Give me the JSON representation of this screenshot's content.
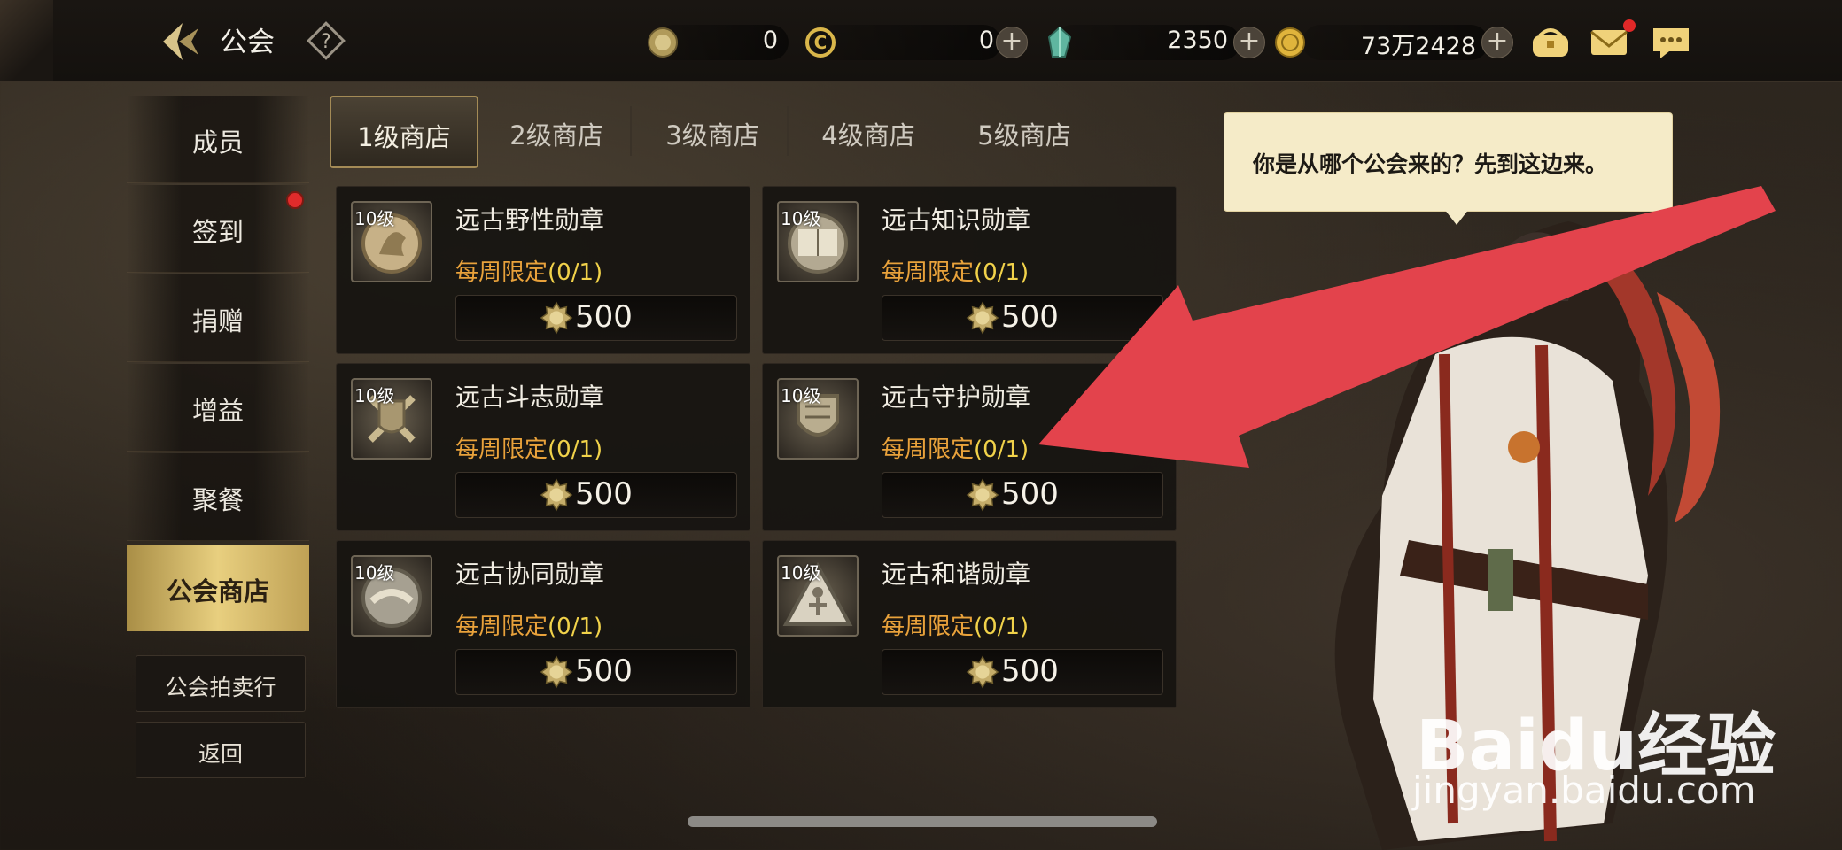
{
  "header": {
    "title": "公会",
    "resources": [
      {
        "icon": "guild-coin-icon",
        "value": "0",
        "has_plus": false
      },
      {
        "icon": "c-currency-icon",
        "value": "0",
        "has_plus": true
      },
      {
        "icon": "crystal-icon",
        "value": "2350",
        "has_plus": true
      },
      {
        "icon": "gold-coin-icon",
        "value": "73万2428",
        "has_plus": true
      }
    ],
    "plus_label": "+"
  },
  "sidebar": {
    "items": [
      {
        "label": "成员",
        "has_dot": false
      },
      {
        "label": "签到",
        "has_dot": true
      },
      {
        "label": "捐赠",
        "has_dot": false
      },
      {
        "label": "增益",
        "has_dot": false
      },
      {
        "label": "聚餐",
        "has_dot": false
      },
      {
        "label": "公会商店",
        "active": true
      }
    ],
    "auction_label": "公会拍卖行",
    "back_label": "返回"
  },
  "tabs": [
    {
      "label": "1级商店",
      "active": true
    },
    {
      "label": "2级商店"
    },
    {
      "label": "3级商店"
    },
    {
      "label": "4级商店"
    },
    {
      "label": "5级商店"
    }
  ],
  "shop": {
    "items": [
      {
        "level": "10级",
        "name": "远古野性勋章",
        "limit_text": "每周限定",
        "limit_count": "(0/1)",
        "price": "500",
        "icon": "wild-medal-icon"
      },
      {
        "level": "10级",
        "name": "远古知识勋章",
        "limit_text": "每周限定",
        "limit_count": "(0/1)",
        "price": "500",
        "icon": "knowledge-medal-icon"
      },
      {
        "level": "10级",
        "name": "远古斗志勋章",
        "limit_text": "每周限定",
        "limit_count": "(0/1)",
        "price": "500",
        "icon": "fighting-medal-icon"
      },
      {
        "level": "10级",
        "name": "远古守护勋章",
        "limit_text": "每周限定",
        "limit_count": "(0/1)",
        "price": "500",
        "icon": "guard-medal-icon"
      },
      {
        "level": "10级",
        "name": "远古协同勋章",
        "limit_text": "每周限定",
        "limit_count": "(0/1)",
        "price": "500",
        "icon": "synergy-medal-icon"
      },
      {
        "level": "10级",
        "name": "远古和谐勋章",
        "limit_text": "每周限定",
        "limit_count": "(0/1)",
        "price": "500",
        "icon": "harmony-medal-icon"
      }
    ]
  },
  "npc": {
    "speech": "你是从哪个公会来的？先到这边来。"
  },
  "watermark": {
    "logo": "Baidu经验",
    "url": "jingyan.baidu.com"
  },
  "colors": {
    "accent_gold": "#e8cf7f",
    "limit_orange": "#e9a23b",
    "arrow_red": "#e3434c"
  }
}
